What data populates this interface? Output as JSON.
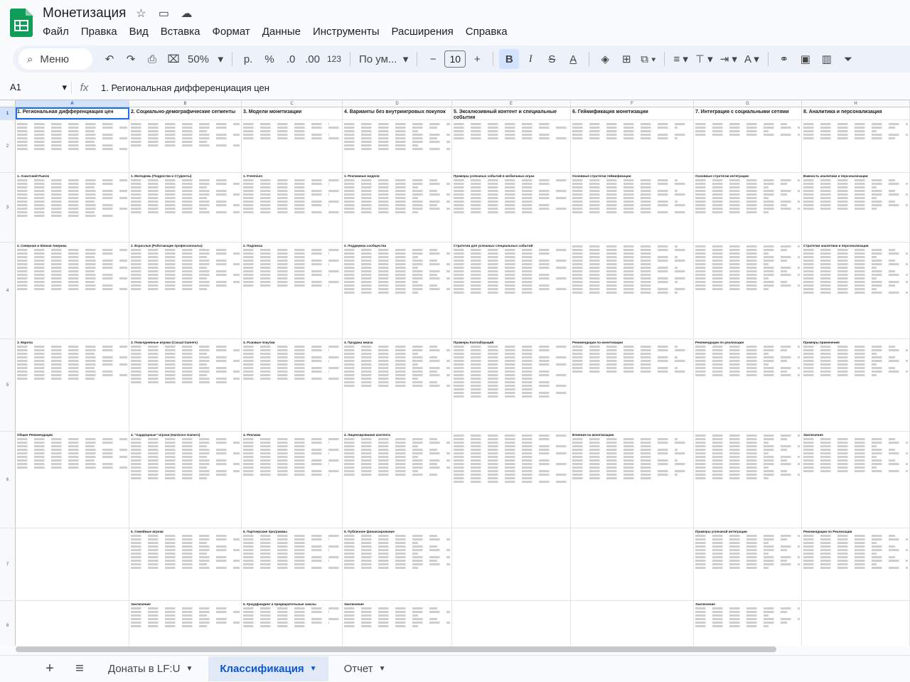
{
  "app": {
    "title": "Монетизация",
    "menus": [
      "Файл",
      "Правка",
      "Вид",
      "Вставка",
      "Формат",
      "Данные",
      "Инструменты",
      "Расширения",
      "Справка"
    ]
  },
  "toolbar": {
    "search_label": "Меню",
    "zoom": "50%",
    "currency": "р.",
    "percent": "%",
    "dec_less": ".0",
    "dec_more": ".00",
    "number_format": "123",
    "font_name": "По ум...",
    "font_size": "10",
    "minus": "−",
    "plus": "+"
  },
  "formula_bar": {
    "cell_ref": "A1",
    "fx": "fx",
    "value": "1. Региональная дифференциация цен"
  },
  "columns": [
    "A",
    "B",
    "C",
    "D",
    "E",
    "F",
    "G",
    "H"
  ],
  "row_numbers": [
    "1",
    "2",
    "3",
    "4",
    "5",
    "6",
    "7",
    "8"
  ],
  "headers": [
    "1. Региональная дифференциация цен",
    "2. Социально-демографические сегменты",
    "3. Модели монетизации",
    "4. Варианты без внутриигровых покупок",
    "5. Эксклюзивный контент и специальные события",
    "6. Геймификация монетизации",
    "7. Интеграция с социальными сетями",
    "8. Аналитика и персонализация"
  ],
  "row3_titles": [
    "1. Азиатский Рынок",
    "1. Молодежь (Подростки и Студенты)",
    "1. Freemium",
    "1. Рекламные модели",
    "Примеры успешных событий в мобильных играх",
    "Основные стратегии геймификации",
    "Основные стратегии интеграции",
    "Важность аналитики и персонализации"
  ],
  "row4_titles": [
    "2. Северная и Южная Америка",
    "2. Взрослые (Работающие профессионалы)",
    "2. Подписка",
    "2. Поддержка сообщества",
    "Стратегии для успешных специальных событий",
    "",
    "",
    "Стратегии аналитики и персонализации"
  ],
  "row5_titles": [
    "3. Европа",
    "3. Повседневные игроки (Casual Gamers)",
    "3. Разовые покупки",
    "3. Продажа мерча",
    "Примеры Коллабораций",
    "Рекомендации по монетизации",
    "Рекомендации по реализации",
    "Примеры применения"
  ],
  "row6_titles": [
    "Общие Рекомендации",
    "4. \"Хардкорные\" игроки (Hardcore Gamers)",
    "4. Реклама",
    "4. Лицензирование контента",
    "",
    "Влияние на монетизацию",
    "",
    "Заключение"
  ],
  "row7_titles": [
    "",
    "5. Семейные игроки",
    "5. Партнерские программы",
    "5. Публичное финансирование",
    "",
    "",
    "Примеры успешной интеграции",
    "Рекомендации по Реализации"
  ],
  "row8_titles": [
    "",
    "Заключение",
    "6. Краудфандинг и предварительные заказы",
    "Заключение",
    "",
    "",
    "Заключение",
    ""
  ],
  "sheets": {
    "tabs": [
      "Донаты в LF:U",
      "Классификация",
      "Отчет"
    ],
    "active": "Классификация"
  }
}
